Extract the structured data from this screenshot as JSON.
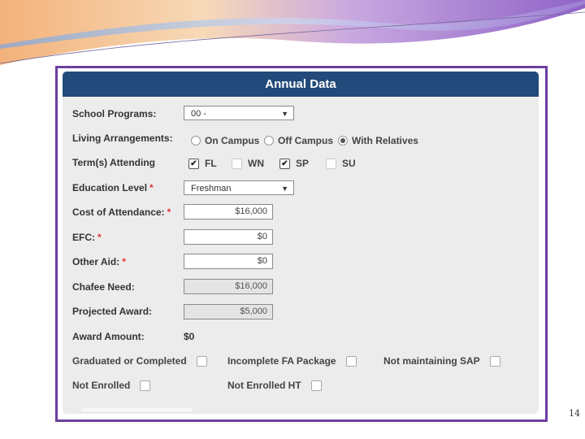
{
  "form": {
    "title": "Annual Data",
    "school_programs_label": "School Programs:",
    "school_programs_value": "00 -",
    "living_label": "Living Arrangements:",
    "living_options": [
      "On Campus",
      "Off Campus",
      "With Relatives"
    ],
    "living_selected": "With Relatives",
    "terms_label": "Term(s) Attending",
    "terms": [
      {
        "label": "FL",
        "checked": true
      },
      {
        "label": "WN",
        "checked": false
      },
      {
        "label": "SP",
        "checked": true
      },
      {
        "label": "SU",
        "checked": false
      }
    ],
    "education_label": "Education Level",
    "education_value": "Freshman",
    "required_mark": "*",
    "coa_label": "Cost of Attendance:",
    "coa_value": "$16,000",
    "efc_label": "EFC:",
    "efc_value": "$0",
    "other_aid_label": "Other Aid:",
    "other_aid_value": "$0",
    "chafee_label": "Chafee Need:",
    "chafee_value": "$16,000",
    "projected_label": "Projected Award:",
    "projected_value": "$5,000",
    "award_label": "Award Amount:",
    "award_value": "$0",
    "flags": [
      {
        "label": "Graduated or Completed",
        "checked": false
      },
      {
        "label": "Incomplete FA Package",
        "checked": false
      },
      {
        "label": "Not maintaining SAP",
        "checked": false
      },
      {
        "label": "Not Enrolled",
        "checked": false
      },
      {
        "label": "Not Enrolled HT",
        "checked": false
      }
    ]
  },
  "page_number": "14",
  "colors": {
    "header": "#234a7a",
    "frame": "#6b3fa0",
    "required": "#dd3333"
  }
}
